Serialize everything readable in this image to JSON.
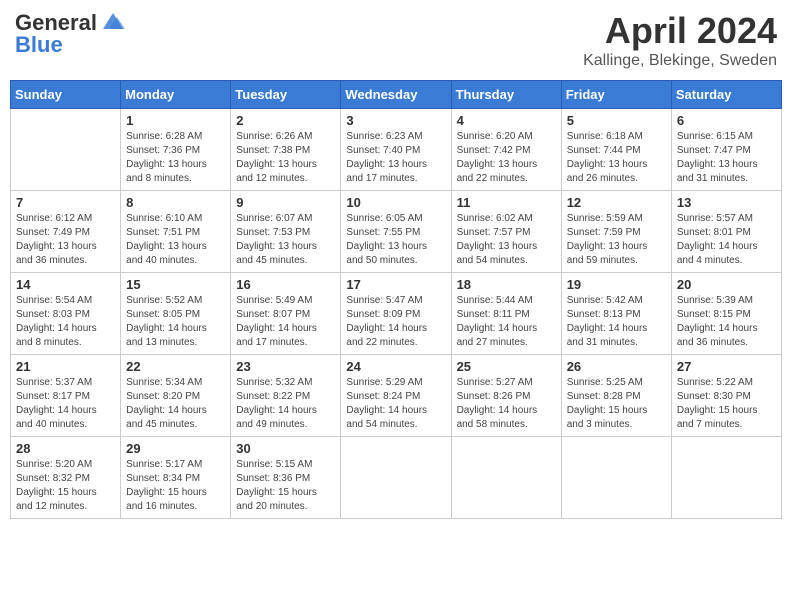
{
  "header": {
    "logo_general": "General",
    "logo_blue": "Blue",
    "month_title": "April 2024",
    "location": "Kallinge, Blekinge, Sweden"
  },
  "days_of_week": [
    "Sunday",
    "Monday",
    "Tuesday",
    "Wednesday",
    "Thursday",
    "Friday",
    "Saturday"
  ],
  "weeks": [
    [
      {
        "day": "",
        "info": ""
      },
      {
        "day": "1",
        "info": "Sunrise: 6:28 AM\nSunset: 7:36 PM\nDaylight: 13 hours\nand 8 minutes."
      },
      {
        "day": "2",
        "info": "Sunrise: 6:26 AM\nSunset: 7:38 PM\nDaylight: 13 hours\nand 12 minutes."
      },
      {
        "day": "3",
        "info": "Sunrise: 6:23 AM\nSunset: 7:40 PM\nDaylight: 13 hours\nand 17 minutes."
      },
      {
        "day": "4",
        "info": "Sunrise: 6:20 AM\nSunset: 7:42 PM\nDaylight: 13 hours\nand 22 minutes."
      },
      {
        "day": "5",
        "info": "Sunrise: 6:18 AM\nSunset: 7:44 PM\nDaylight: 13 hours\nand 26 minutes."
      },
      {
        "day": "6",
        "info": "Sunrise: 6:15 AM\nSunset: 7:47 PM\nDaylight: 13 hours\nand 31 minutes."
      }
    ],
    [
      {
        "day": "7",
        "info": "Sunrise: 6:12 AM\nSunset: 7:49 PM\nDaylight: 13 hours\nand 36 minutes."
      },
      {
        "day": "8",
        "info": "Sunrise: 6:10 AM\nSunset: 7:51 PM\nDaylight: 13 hours\nand 40 minutes."
      },
      {
        "day": "9",
        "info": "Sunrise: 6:07 AM\nSunset: 7:53 PM\nDaylight: 13 hours\nand 45 minutes."
      },
      {
        "day": "10",
        "info": "Sunrise: 6:05 AM\nSunset: 7:55 PM\nDaylight: 13 hours\nand 50 minutes."
      },
      {
        "day": "11",
        "info": "Sunrise: 6:02 AM\nSunset: 7:57 PM\nDaylight: 13 hours\nand 54 minutes."
      },
      {
        "day": "12",
        "info": "Sunrise: 5:59 AM\nSunset: 7:59 PM\nDaylight: 13 hours\nand 59 minutes."
      },
      {
        "day": "13",
        "info": "Sunrise: 5:57 AM\nSunset: 8:01 PM\nDaylight: 14 hours\nand 4 minutes."
      }
    ],
    [
      {
        "day": "14",
        "info": "Sunrise: 5:54 AM\nSunset: 8:03 PM\nDaylight: 14 hours\nand 8 minutes."
      },
      {
        "day": "15",
        "info": "Sunrise: 5:52 AM\nSunset: 8:05 PM\nDaylight: 14 hours\nand 13 minutes."
      },
      {
        "day": "16",
        "info": "Sunrise: 5:49 AM\nSunset: 8:07 PM\nDaylight: 14 hours\nand 17 minutes."
      },
      {
        "day": "17",
        "info": "Sunrise: 5:47 AM\nSunset: 8:09 PM\nDaylight: 14 hours\nand 22 minutes."
      },
      {
        "day": "18",
        "info": "Sunrise: 5:44 AM\nSunset: 8:11 PM\nDaylight: 14 hours\nand 27 minutes."
      },
      {
        "day": "19",
        "info": "Sunrise: 5:42 AM\nSunset: 8:13 PM\nDaylight: 14 hours\nand 31 minutes."
      },
      {
        "day": "20",
        "info": "Sunrise: 5:39 AM\nSunset: 8:15 PM\nDaylight: 14 hours\nand 36 minutes."
      }
    ],
    [
      {
        "day": "21",
        "info": "Sunrise: 5:37 AM\nSunset: 8:17 PM\nDaylight: 14 hours\nand 40 minutes."
      },
      {
        "day": "22",
        "info": "Sunrise: 5:34 AM\nSunset: 8:20 PM\nDaylight: 14 hours\nand 45 minutes."
      },
      {
        "day": "23",
        "info": "Sunrise: 5:32 AM\nSunset: 8:22 PM\nDaylight: 14 hours\nand 49 minutes."
      },
      {
        "day": "24",
        "info": "Sunrise: 5:29 AM\nSunset: 8:24 PM\nDaylight: 14 hours\nand 54 minutes."
      },
      {
        "day": "25",
        "info": "Sunrise: 5:27 AM\nSunset: 8:26 PM\nDaylight: 14 hours\nand 58 minutes."
      },
      {
        "day": "26",
        "info": "Sunrise: 5:25 AM\nSunset: 8:28 PM\nDaylight: 15 hours\nand 3 minutes."
      },
      {
        "day": "27",
        "info": "Sunrise: 5:22 AM\nSunset: 8:30 PM\nDaylight: 15 hours\nand 7 minutes."
      }
    ],
    [
      {
        "day": "28",
        "info": "Sunrise: 5:20 AM\nSunset: 8:32 PM\nDaylight: 15 hours\nand 12 minutes."
      },
      {
        "day": "29",
        "info": "Sunrise: 5:17 AM\nSunset: 8:34 PM\nDaylight: 15 hours\nand 16 minutes."
      },
      {
        "day": "30",
        "info": "Sunrise: 5:15 AM\nSunset: 8:36 PM\nDaylight: 15 hours\nand 20 minutes."
      },
      {
        "day": "",
        "info": ""
      },
      {
        "day": "",
        "info": ""
      },
      {
        "day": "",
        "info": ""
      },
      {
        "day": "",
        "info": ""
      }
    ]
  ]
}
